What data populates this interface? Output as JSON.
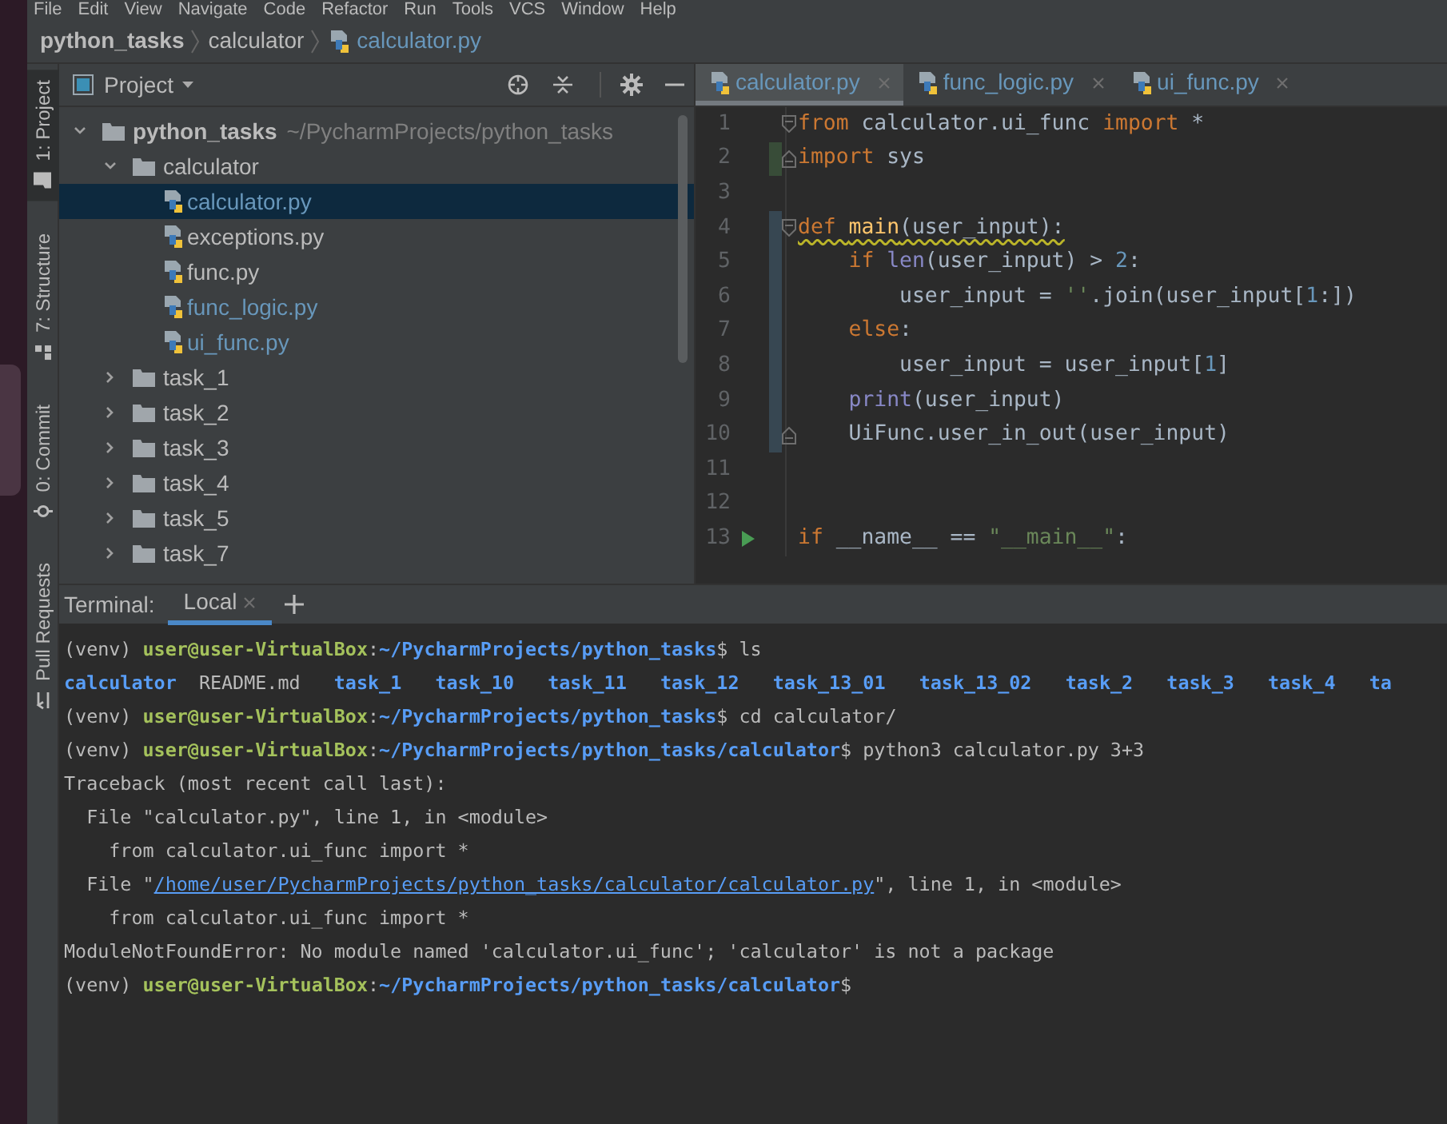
{
  "menu": [
    "File",
    "Edit",
    "View",
    "Navigate",
    "Code",
    "Refactor",
    "Run",
    "Tools",
    "VCS",
    "Window",
    "Help"
  ],
  "breadcrumb": [
    {
      "label": "python_tasks",
      "kind": "project"
    },
    {
      "label": "calculator",
      "kind": "folder"
    },
    {
      "label": "calculator.py",
      "kind": "file"
    }
  ],
  "tool_tabs": [
    {
      "label": "1: Project",
      "kind": "project",
      "selected": true
    },
    {
      "label": "7: Structure",
      "kind": "structure",
      "selected": false
    },
    {
      "label": "0: Commit",
      "kind": "commit",
      "selected": false
    },
    {
      "label": "Pull Requests",
      "kind": "pull-requests",
      "selected": false
    }
  ],
  "project_panel": {
    "title": "Project",
    "tree": [
      {
        "label": "python_tasks",
        "hint": "~/PycharmProjects/python_tasks",
        "kind": "folder",
        "expanded": true,
        "selected": false,
        "modified": false,
        "children": [
          {
            "label": "calculator",
            "kind": "folder",
            "expanded": true,
            "selected": false,
            "modified": false,
            "children": [
              {
                "label": "calculator.py",
                "kind": "file",
                "selected": true,
                "modified": true
              },
              {
                "label": "exceptions.py",
                "kind": "file",
                "selected": false,
                "modified": false
              },
              {
                "label": "func.py",
                "kind": "file",
                "selected": false,
                "modified": false
              },
              {
                "label": "func_logic.py",
                "kind": "file",
                "selected": false,
                "modified": true
              },
              {
                "label": "ui_func.py",
                "kind": "file",
                "selected": false,
                "modified": true
              }
            ]
          },
          {
            "label": "task_1",
            "kind": "folder",
            "expanded": false,
            "selected": false,
            "modified": false
          },
          {
            "label": "task_2",
            "kind": "folder",
            "expanded": false,
            "selected": false,
            "modified": false
          },
          {
            "label": "task_3",
            "kind": "folder",
            "expanded": false,
            "selected": false,
            "modified": false
          },
          {
            "label": "task_4",
            "kind": "folder",
            "expanded": false,
            "selected": false,
            "modified": false
          },
          {
            "label": "task_5",
            "kind": "folder",
            "expanded": false,
            "selected": false,
            "modified": false
          },
          {
            "label": "task_7",
            "kind": "folder",
            "expanded": false,
            "selected": false,
            "modified": false
          }
        ]
      }
    ]
  },
  "editor": {
    "tabs": [
      {
        "label": "calculator.py",
        "selected": true
      },
      {
        "label": "func_logic.py",
        "selected": false
      },
      {
        "label": "ui_func.py",
        "selected": false
      }
    ],
    "lines": [
      {
        "number": "1",
        "fold_start": true,
        "fold_end": false,
        "added": false,
        "modified": false,
        "run": false,
        "warning": false,
        "tokens": [
          {
            "kind": "keyword",
            "text": "from"
          },
          {
            "kind": "plain",
            "text": " calculator.ui_func "
          },
          {
            "kind": "keyword",
            "text": "import"
          },
          {
            "kind": "plain",
            "text": " *"
          }
        ]
      },
      {
        "number": "2",
        "fold_start": false,
        "fold_end": true,
        "added": true,
        "modified": false,
        "run": false,
        "warning": false,
        "tokens": [
          {
            "kind": "keyword",
            "text": "import"
          },
          {
            "kind": "plain",
            "text": " sys"
          }
        ]
      },
      {
        "number": "3",
        "fold_start": false,
        "fold_end": false,
        "added": false,
        "modified": false,
        "run": false,
        "warning": false
      },
      {
        "number": "4",
        "fold_start": true,
        "fold_end": false,
        "added": false,
        "modified": true,
        "run": false,
        "warning": true,
        "tokens": [
          {
            "kind": "keyword",
            "text": "def "
          },
          {
            "kind": "function",
            "text": "main"
          },
          {
            "kind": "plain",
            "text": "(user_input):"
          }
        ]
      },
      {
        "number": "5",
        "fold_start": false,
        "fold_end": false,
        "added": false,
        "modified": true,
        "run": false,
        "warning": false,
        "tokens": [
          {
            "kind": "keyword",
            "text": "    if "
          },
          {
            "kind": "builtin",
            "text": "len"
          },
          {
            "kind": "plain",
            "text": "(user_input) > "
          },
          {
            "kind": "number",
            "text": "2"
          },
          {
            "kind": "plain",
            "text": ":"
          }
        ]
      },
      {
        "number": "6",
        "fold_start": false,
        "fold_end": false,
        "added": false,
        "modified": true,
        "run": false,
        "warning": false,
        "tokens": [
          {
            "kind": "plain",
            "text": "        user_input = "
          },
          {
            "kind": "string",
            "text": "''"
          },
          {
            "kind": "plain",
            "text": ".join(user_input["
          },
          {
            "kind": "number",
            "text": "1"
          },
          {
            "kind": "plain",
            "text": ":])"
          }
        ]
      },
      {
        "number": "7",
        "fold_start": false,
        "fold_end": false,
        "added": false,
        "modified": true,
        "run": false,
        "warning": false,
        "tokens": [
          {
            "kind": "keyword",
            "text": "    else"
          },
          {
            "kind": "plain",
            "text": ":"
          }
        ]
      },
      {
        "number": "8",
        "fold_start": false,
        "fold_end": false,
        "added": false,
        "modified": true,
        "run": false,
        "warning": false,
        "tokens": [
          {
            "kind": "plain",
            "text": "        user_input = user_input["
          },
          {
            "kind": "number",
            "text": "1"
          },
          {
            "kind": "plain",
            "text": "]"
          }
        ]
      },
      {
        "number": "9",
        "fold_start": false,
        "fold_end": false,
        "added": false,
        "modified": true,
        "run": false,
        "warning": false,
        "tokens": [
          {
            "kind": "builtin",
            "text": "    print"
          },
          {
            "kind": "plain",
            "text": "(user_input)"
          }
        ]
      },
      {
        "number": "10",
        "fold_start": false,
        "fold_end": true,
        "added": false,
        "modified": true,
        "run": false,
        "warning": false,
        "tokens": [
          {
            "kind": "plain",
            "text": "    UiFunc.user_in_out(user_input)"
          }
        ]
      },
      {
        "number": "11",
        "fold_start": false,
        "fold_end": false,
        "added": false,
        "modified": false,
        "run": false,
        "warning": false
      },
      {
        "number": "12",
        "fold_start": false,
        "fold_end": false,
        "added": false,
        "modified": false,
        "run": false,
        "warning": false
      },
      {
        "number": "13",
        "fold_start": false,
        "fold_end": false,
        "added": false,
        "modified": false,
        "run": true,
        "warning": false,
        "tokens": [
          {
            "kind": "keyword",
            "text": "if"
          },
          {
            "kind": "plain",
            "text": " __name__ == "
          },
          {
            "kind": "string",
            "text": "\"__main__\""
          },
          {
            "kind": "plain",
            "text": ":"
          }
        ]
      }
    ]
  },
  "terminal": {
    "title": "Terminal:",
    "tabs": [
      {
        "label": "Local",
        "selected": true
      }
    ],
    "lines": [
      [
        {
          "kind": "plain",
          "text": "(venv) "
        },
        {
          "kind": "user",
          "text": "user@user-VirtualBox"
        },
        {
          "kind": "plain",
          "text": ":"
        },
        {
          "kind": "path",
          "text": "~/PycharmProjects/python_tasks"
        },
        {
          "kind": "plain",
          "text": "$ ls"
        }
      ],
      [
        {
          "kind": "dir",
          "text": "calculator"
        },
        {
          "kind": "plain",
          "text": "  README.md   "
        },
        {
          "kind": "dir",
          "text": "task_1   "
        },
        {
          "kind": "dir",
          "text": "task_10   "
        },
        {
          "kind": "dir",
          "text": "task_11   "
        },
        {
          "kind": "dir",
          "text": "task_12   "
        },
        {
          "kind": "dir",
          "text": "task_13_01   "
        },
        {
          "kind": "dir",
          "text": "task_13_02   "
        },
        {
          "kind": "dir",
          "text": "task_2   "
        },
        {
          "kind": "dir",
          "text": "task_3   "
        },
        {
          "kind": "dir",
          "text": "task_4   "
        },
        {
          "kind": "dir",
          "text": "ta"
        }
      ],
      [
        {
          "kind": "plain",
          "text": "(venv) "
        },
        {
          "kind": "user",
          "text": "user@user-VirtualBox"
        },
        {
          "kind": "plain",
          "text": ":"
        },
        {
          "kind": "path",
          "text": "~/PycharmProjects/python_tasks"
        },
        {
          "kind": "plain",
          "text": "$ cd calculator/"
        }
      ],
      [
        {
          "kind": "plain",
          "text": "(venv) "
        },
        {
          "kind": "user",
          "text": "user@user-VirtualBox"
        },
        {
          "kind": "plain",
          "text": ":"
        },
        {
          "kind": "path",
          "text": "~/PycharmProjects/python_tasks/calculator"
        },
        {
          "kind": "plain",
          "text": "$ python3 calculator.py 3+3"
        }
      ],
      [
        {
          "kind": "plain",
          "text": "Traceback (most recent call last):"
        }
      ],
      [
        {
          "kind": "plain",
          "text": "  File \"calculator.py\", line 1, in <module>"
        }
      ],
      [
        {
          "kind": "plain",
          "text": "    from calculator.ui_func import *"
        }
      ],
      [
        {
          "kind": "plain",
          "text": "  File \""
        },
        {
          "kind": "link",
          "text": "/home/user/PycharmProjects/python_tasks/calculator/calculator.py"
        },
        {
          "kind": "plain",
          "text": "\", line 1, in <module>"
        }
      ],
      [
        {
          "kind": "plain",
          "text": "    from calculator.ui_func import *"
        }
      ],
      [
        {
          "kind": "plain",
          "text": "ModuleNotFoundError: No module named 'calculator.ui_func'; 'calculator' is not a package"
        }
      ],
      [
        {
          "kind": "plain",
          "text": "(venv) "
        },
        {
          "kind": "user",
          "text": "user@user-VirtualBox"
        },
        {
          "kind": "plain",
          "text": ":"
        },
        {
          "kind": "path",
          "text": "~/PycharmProjects/python_tasks/calculator"
        },
        {
          "kind": "plain",
          "text": "$"
        }
      ]
    ]
  }
}
